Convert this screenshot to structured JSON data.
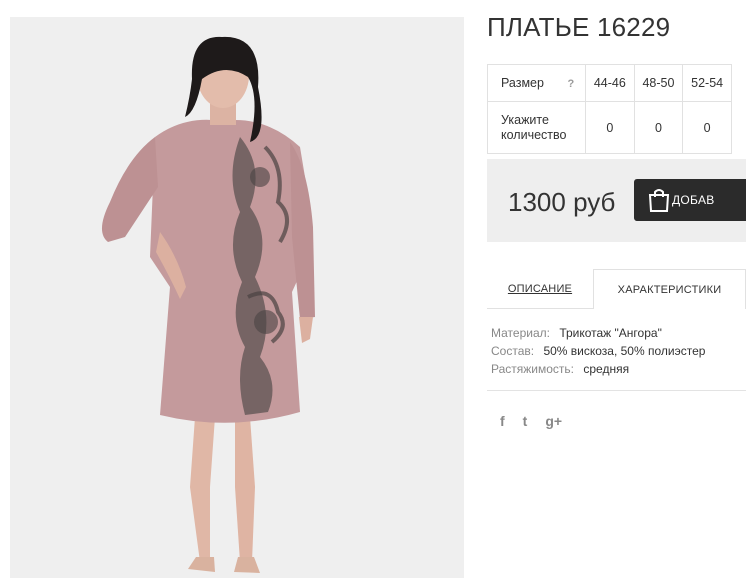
{
  "product": {
    "title": "ПЛАТЬЕ 16229",
    "image_alt": "dress-photo"
  },
  "size_table": {
    "size_label": "Размер",
    "help": "?",
    "sizes": [
      "44-46",
      "48-50",
      "52-54"
    ],
    "qty_label_line1": "Укажите",
    "qty_label_line2": "количество",
    "quantities": [
      "0",
      "0",
      "0"
    ]
  },
  "purchase": {
    "price": "1300 руб",
    "buy_label": "ДОБАВ"
  },
  "tabs": {
    "description": "ОПИСАНИЕ",
    "specs": "ХАРАКТЕРИСТИКИ"
  },
  "specs": [
    {
      "key": "Материал:",
      "value": "Трикотаж \"Ангора\""
    },
    {
      "key": "Состав:",
      "value": "50% вискоза, 50% полиэстер"
    },
    {
      "key": "Растяжимость:",
      "value": "средняя"
    }
  ],
  "social": {
    "facebook": "f",
    "twitter": "t",
    "google": "g+"
  },
  "colors": {
    "dress": "#c49a9c",
    "button": "#2b2b2b",
    "price_bg": "#eeeeee"
  }
}
